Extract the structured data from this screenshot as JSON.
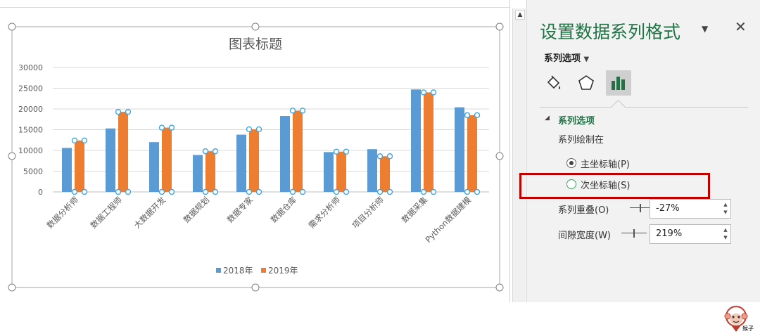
{
  "chart_data": {
    "type": "bar",
    "title": "图表标题",
    "categories": [
      "数据分析师",
      "数据工程师",
      "大数据开发",
      "数据规划",
      "数据专家",
      "数据仓库",
      "需求分析师",
      "项目分析师",
      "数据采集",
      "Python数据建模"
    ],
    "series": [
      {
        "name": "2018年",
        "color": "#5b9bd5",
        "values": [
          10600,
          15300,
          12000,
          8900,
          13800,
          18300,
          9600,
          10300,
          24700,
          20400
        ]
      },
      {
        "name": "2019年",
        "color": "#ed7d31",
        "values": [
          12400,
          19300,
          15500,
          9800,
          15100,
          19600,
          9700,
          8600,
          24000,
          18500
        ]
      }
    ],
    "yticks": [
      "30000",
      "25000",
      "20000",
      "15000",
      "10000",
      "5000",
      "0"
    ],
    "ylim": [
      0,
      30000
    ],
    "grid": true,
    "legend": "bottom",
    "selected_series": "2019年"
  },
  "pane": {
    "title": "设置数据系列格式",
    "menu_icon": "▼",
    "close_icon": "✕",
    "series_dropdown": "系列选项",
    "tabs": [
      "fill-line-icon",
      "effects-icon",
      "series-options-icon"
    ],
    "section_toggle": "◢",
    "section_title": "系列选项",
    "plot_on_label": "系列绘制在",
    "radio_primary": "主坐标轴(P)",
    "radio_secondary": "次坐标轴(S)",
    "overlap_label": "系列重叠(O)",
    "overlap_value": "-27%",
    "gap_label": "间隙宽度(W)",
    "gap_value": "219%",
    "spin_up": "▲",
    "spin_down": "▼"
  },
  "scrollbar": {
    "up_arrow": "▲"
  },
  "watermark": {
    "text": "猴子"
  }
}
